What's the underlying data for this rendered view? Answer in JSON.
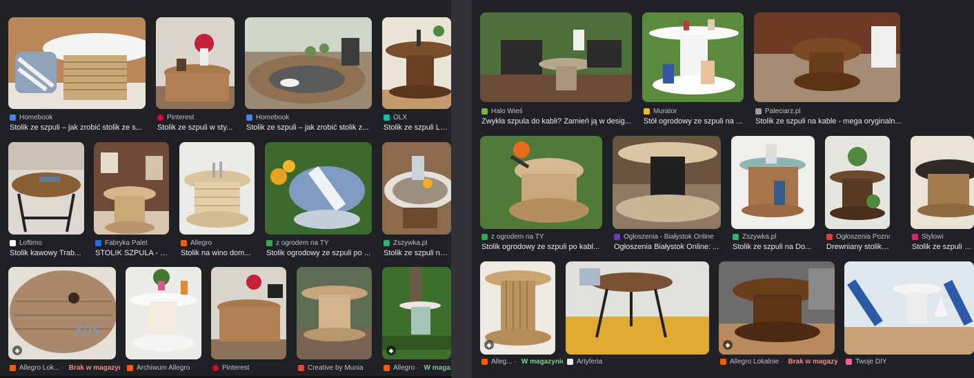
{
  "left_panel": {
    "cards": [
      {
        "source": "Homebook",
        "title": "Stolik ze szpuli – jak zrobić stolik ze s...",
        "fav": "#4285f4",
        "stock": ""
      },
      {
        "source": "Pinterest",
        "title": "Stolik ze szpuli w sty...",
        "fav": "#e60023",
        "stock": ""
      },
      {
        "source": "Homebook",
        "title": "Stolik ze szpuli – jak zrobić stolik z...",
        "fav": "#4285f4",
        "stock": ""
      },
      {
        "source": "OLX",
        "title": "Stolik ze szpuli Loft...",
        "fav": "#00c2b3",
        "stock": ""
      },
      {
        "source": "Loftimo",
        "title": "Stolik kawowy Trab...",
        "fav": "#ffffff",
        "stock": ""
      },
      {
        "source": "Fabryka Palet",
        "title": "STOLIK SZPULA - F...",
        "fav": "#1a73e8",
        "stock": ""
      },
      {
        "source": "Allegro",
        "title": "Stolik na wino dom...",
        "fav": "#ff5a00",
        "stock": ""
      },
      {
        "source": "z ogrodem na TY",
        "title": "Stolik ogrodowy ze szpuli po ...",
        "fav": "#34a853",
        "stock": ""
      },
      {
        "source": "Zszywka.pl",
        "title": "Stolik ze szpuli na Z...",
        "fav": "#2bb673",
        "stock": ""
      },
      {
        "source": "Allegro Lok...",
        "title": "",
        "fav": "#ff5a00",
        "stock": "Brak w magazynie",
        "stock_color": "#f28b82"
      },
      {
        "source": "Archiwum Allegro",
        "title": "",
        "fav": "#ff5a00",
        "stock": ""
      },
      {
        "source": "Pinterest",
        "title": "",
        "fav": "#e60023",
        "stock": ""
      },
      {
        "source": "Creative by Munia",
        "title": "",
        "fav": "#e8453c",
        "stock": ""
      },
      {
        "source": "Allegro",
        "title": "",
        "fav": "#ff5a00",
        "stock": "W magazynie",
        "stock_color": "#81c995"
      }
    ]
  },
  "right_panel": {
    "cards": [
      {
        "source": "Halo Wieś",
        "title": "Zwykła szpula do kabli? Zamień ją w desig...",
        "fav": "#7cb342",
        "stock": ""
      },
      {
        "source": "Murator",
        "title": "Stół ogrodowy ze szpuli na ...",
        "fav": "#fbbc04",
        "stock": ""
      },
      {
        "source": "Paleciarz.pl",
        "title": "Stolik ze szpuli na kable - mega oryginaln...",
        "fav": "#9aa0a6",
        "stock": ""
      },
      {
        "source": "z ogrodem na TY",
        "title": "Stolik ogrodowy ze szpuli po kabl...",
        "fav": "#34a853",
        "stock": ""
      },
      {
        "source": "Ogłoszenia - Białystok Online",
        "title": "Ogłoszenia Białystok Online: ...",
        "fav": "#673ab7",
        "stock": ""
      },
      {
        "source": "Zszywka.pl",
        "title": "Stolik ze szpuli na Do...",
        "fav": "#2bb673",
        "stock": ""
      },
      {
        "source": "Ogłoszenia Poznań -...",
        "title": "Drewniany stolik ze ...",
        "fav": "#e53935",
        "stock": ""
      },
      {
        "source": "Stylowi",
        "title": "Stolik ze szpuli na ...",
        "fav": "#e91e63",
        "stock": ""
      },
      {
        "source": "Alleg...",
        "title": "",
        "fav": "#ff5a00",
        "stock": "W magazynie",
        "stock_color": "#81c995"
      },
      {
        "source": "Artyferia",
        "title": "",
        "fav": "#e8eaed",
        "stock": ""
      },
      {
        "source": "Allegro Lokalnie",
        "title": "",
        "fav": "#ff5a00",
        "stock": "Brak w magazynie",
        "stock_color": "#f28b82"
      },
      {
        "source": "Twoje DIY",
        "title": "",
        "fav": "#f06292",
        "stock": ""
      }
    ]
  }
}
